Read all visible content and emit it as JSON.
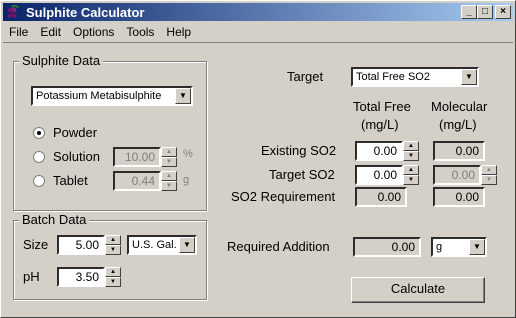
{
  "window": {
    "title": "Sulphite Calculator",
    "buttons": {
      "minimize": "_",
      "maximize": "□",
      "close": "×"
    }
  },
  "menu": [
    {
      "label": "File"
    },
    {
      "label": "Edit"
    },
    {
      "label": "Options"
    },
    {
      "label": "Tools"
    },
    {
      "label": "Help"
    }
  ],
  "sulphite_data": {
    "group_label": "Sulphite Data",
    "compound": "Potassium Metabisulphite",
    "form_options": [
      {
        "label": "Powder",
        "selected": true
      },
      {
        "label": "Solution",
        "selected": false,
        "value": "10.00",
        "unit": "%"
      },
      {
        "label": "Tablet",
        "selected": false,
        "value": "0.44",
        "unit": "g"
      }
    ]
  },
  "batch_data": {
    "group_label": "Batch Data",
    "size_label": "Size",
    "size_value": "5.00",
    "size_unit": "U.S. Gal.",
    "ph_label": "pH",
    "ph_value": "3.50"
  },
  "target": {
    "label": "Target",
    "selected": "Total Free SO2"
  },
  "columns": {
    "total_free": "Total Free",
    "total_free_unit": "(mg/L)",
    "molecular": "Molecular",
    "molecular_unit": "(mg/L)"
  },
  "rows": {
    "existing": {
      "label": "Existing SO2",
      "total_free": "0.00",
      "molecular": "0.00"
    },
    "target": {
      "label": "Target SO2",
      "total_free": "0.00",
      "molecular": "0.00"
    },
    "requirement": {
      "label": "SO2 Requirement",
      "total_free": "0.00",
      "molecular": "0.00"
    }
  },
  "required_addition": {
    "label": "Required Addition",
    "value": "0.00",
    "unit": "g"
  },
  "calculate_label": "Calculate",
  "spin_glyphs": {
    "up": "▲",
    "down": "▼"
  },
  "dropdown_glyph": "▼"
}
